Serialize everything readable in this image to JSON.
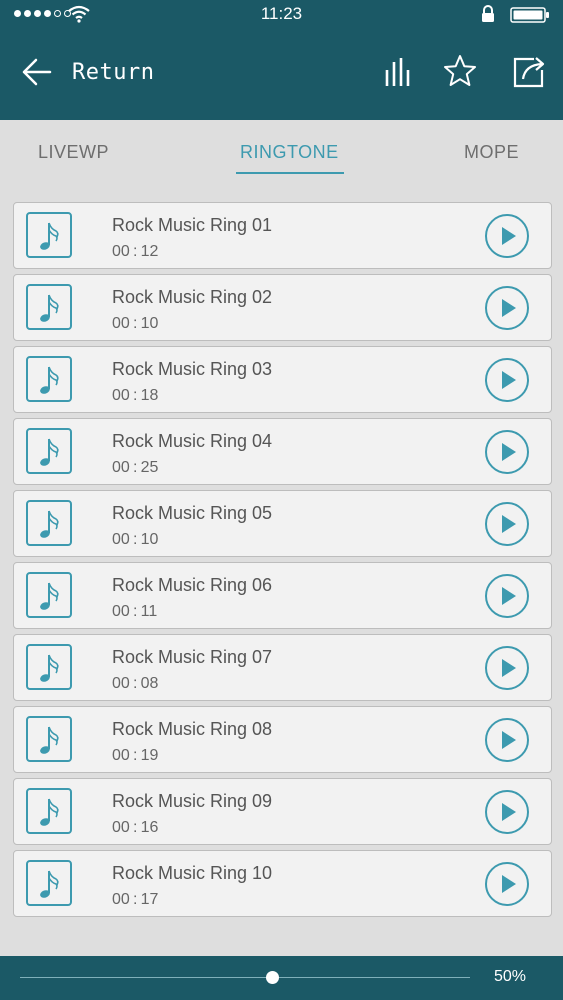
{
  "status": {
    "time": "11:23",
    "signal_dots": [
      true,
      true,
      true,
      true,
      false,
      false
    ]
  },
  "nav": {
    "title": "Return",
    "icons": [
      "back-arrow-icon",
      "equalizer-icon",
      "star-icon",
      "share-icon"
    ]
  },
  "tabs": [
    {
      "label": "LIVEWP",
      "active": false
    },
    {
      "label": "RINGTONE",
      "active": true
    },
    {
      "label": "MOPE",
      "active": false
    }
  ],
  "ringtones": [
    {
      "name": "Rock Music Ring 01",
      "duration": "00 : 12"
    },
    {
      "name": "Rock Music Ring 02",
      "duration": "00 : 10"
    },
    {
      "name": "Rock Music Ring 03",
      "duration": "00 : 18"
    },
    {
      "name": "Rock Music Ring 04",
      "duration": "00 : 25"
    },
    {
      "name": "Rock Music Ring 05",
      "duration": "00 : 10"
    },
    {
      "name": "Rock Music Ring 06",
      "duration": "00 : 11"
    },
    {
      "name": "Rock Music Ring 07",
      "duration": "00 : 08"
    },
    {
      "name": "Rock Music Ring 08",
      "duration": "00 : 19"
    },
    {
      "name": "Rock Music Ring 09",
      "duration": "00 : 16"
    },
    {
      "name": "Rock Music Ring 10",
      "duration": "00 : 17"
    }
  ],
  "volume": {
    "label": "50%",
    "level": 0.56
  },
  "colors": {
    "header": "#1b5966",
    "accent": "#3d9aaf",
    "background": "#dedede"
  }
}
